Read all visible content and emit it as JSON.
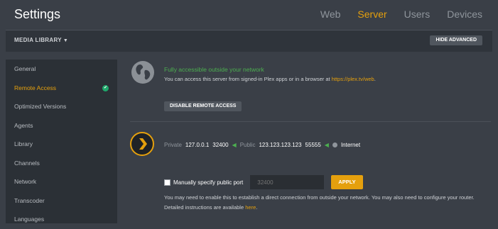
{
  "app": {
    "title": "Settings"
  },
  "nav": {
    "tabs": [
      "Web",
      "Server",
      "Users",
      "Devices"
    ],
    "active": "Server",
    "accent": "#e5a00d"
  },
  "subbar": {
    "library_menu": "MEDIA LIBRARY",
    "hide_advanced": "HIDE ADVANCED"
  },
  "sidebar": {
    "items": [
      {
        "label": "General"
      },
      {
        "label": "Remote Access",
        "active": true
      },
      {
        "label": "Optimized Versions"
      },
      {
        "label": "Agents"
      },
      {
        "label": "Library"
      },
      {
        "label": "Channels"
      },
      {
        "label": "Network"
      },
      {
        "label": "Transcoder"
      },
      {
        "label": "Languages"
      }
    ]
  },
  "remote": {
    "status": "Fully accessible outside your network",
    "desc_prefix": "You can access this server from signed-in Plex apps or in a browser at",
    "desc_link": "https://plex.tv/web",
    "desc_suffix": ".",
    "disable_button": "DISABLE REMOTE ACCESS"
  },
  "connection": {
    "private_label": "Private",
    "private_ip": "127.0.0.1",
    "private_port": "32400",
    "public_label": "Public",
    "public_ip": "123.123.123.123",
    "public_port": "55555",
    "internet_label": "Internet"
  },
  "port": {
    "checkbox_label": "Manually specify public port",
    "placeholder": "32400",
    "apply_button": "APPLY"
  },
  "info": {
    "text_prefix": "You may need to enable this to establish a direct connection from outside your network. You may also need to configure your router. Detailed instructions are available",
    "link": "here",
    "text_suffix": "."
  }
}
